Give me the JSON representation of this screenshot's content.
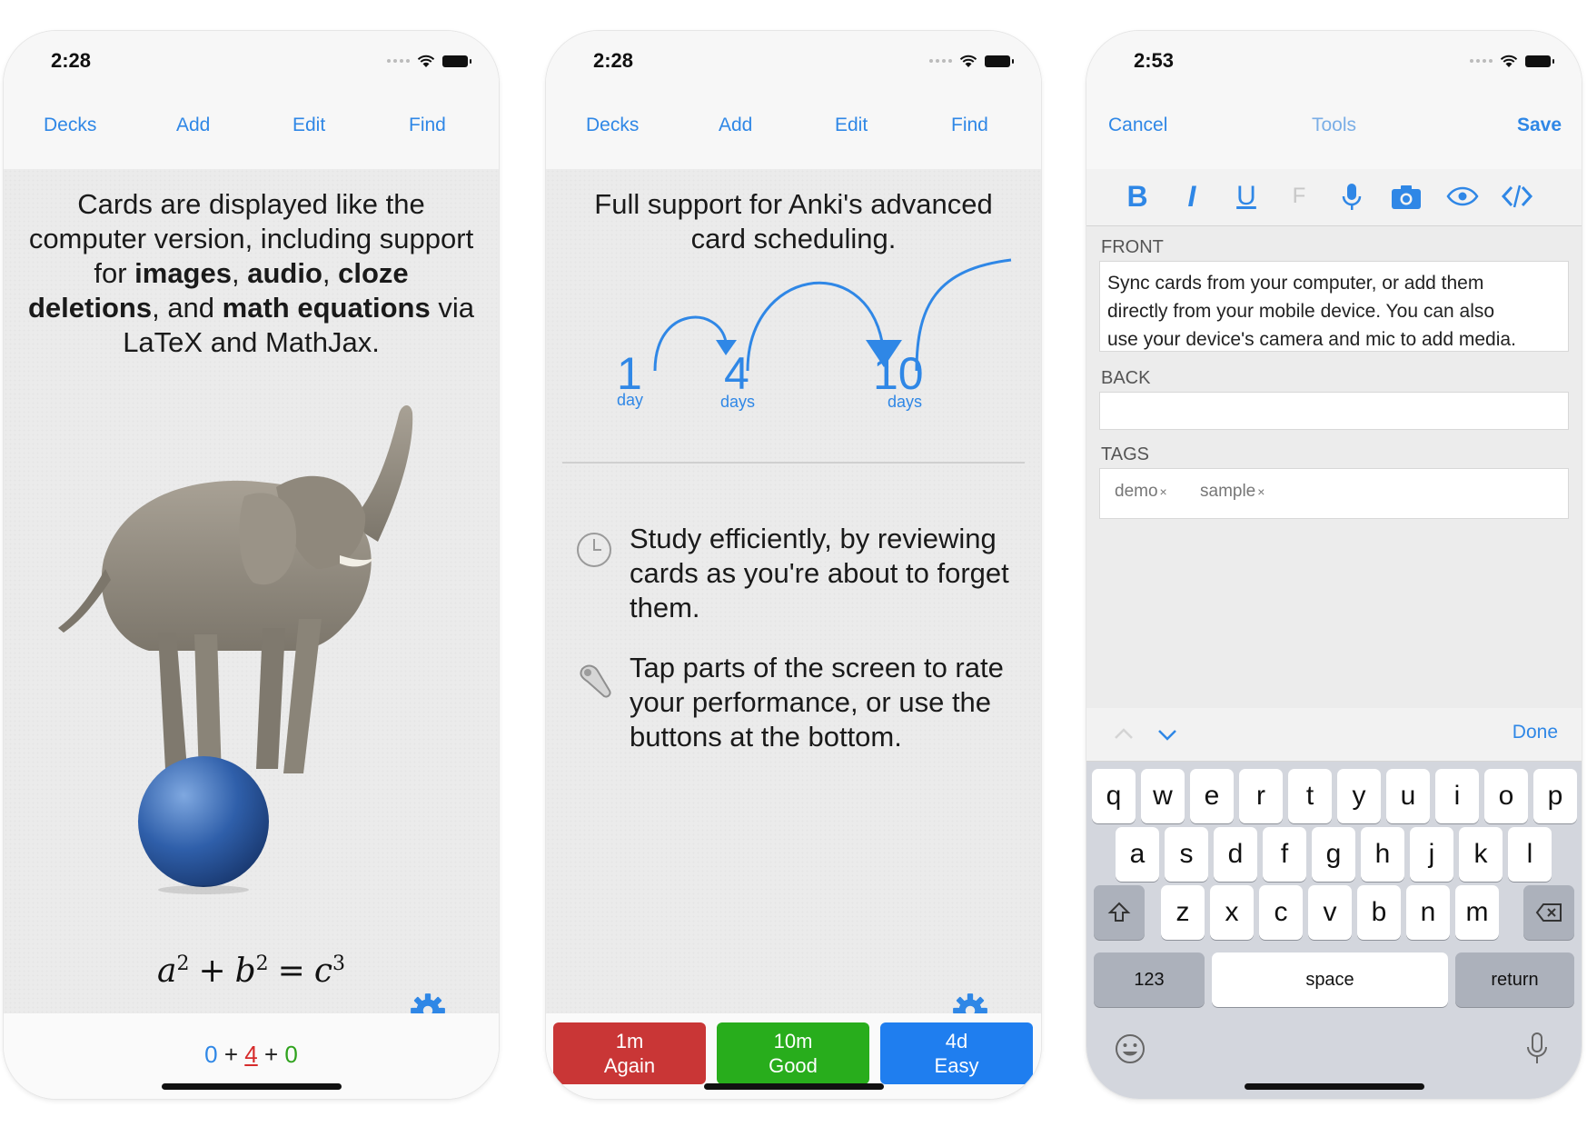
{
  "phones": [
    {
      "status": {
        "time": "2:28"
      },
      "nav": {
        "decks": "Decks",
        "add": "Add",
        "edit": "Edit",
        "find": "Find"
      },
      "card": {
        "l1": "Cards are displayed like the",
        "l2": "computer version, including support",
        "l3a": "for ",
        "images": "images",
        "l3b": ", ",
        "audio": "audio",
        "l3c": ", ",
        "cloze": "cloze",
        "deletions": "deletions",
        "l4": ", and ",
        "math": "math equations",
        "l4b": " via",
        "l5": "LaTeX and MathJax."
      },
      "equation": {
        "a": "a",
        "b": "b",
        "c": "c",
        "e1": "2",
        "e2": "2",
        "e3": "3",
        "plus": "+",
        "eq": "="
      },
      "counts": {
        "new": "0",
        "learn": "4",
        "review": "0",
        "plus": "+"
      },
      "icons": [
        "gear-icon",
        "elephant-on-ball-image"
      ]
    },
    {
      "status": {
        "time": "2:28"
      },
      "nav": {
        "decks": "Decks",
        "add": "Add",
        "edit": "Edit",
        "find": "Find"
      },
      "headline": {
        "l1": "Full support for Anki's advanced",
        "l2": "card scheduling."
      },
      "intervals": [
        {
          "num": "1",
          "unit": "day"
        },
        {
          "num": "4",
          "unit": "days"
        },
        {
          "num": "10",
          "unit": "days"
        }
      ],
      "features": [
        {
          "icon": "clock-icon",
          "l1": "Study efficiently, by reviewing",
          "l2": "cards as you're about to forget",
          "l3": "them."
        },
        {
          "icon": "tap-icon",
          "l1": "Tap parts of the screen to rate",
          "l2": "your performance, or use the",
          "l3": "buttons at the bottom."
        }
      ],
      "answers": [
        {
          "time": "1m",
          "label": "Again",
          "color": "#c93636"
        },
        {
          "time": "10m",
          "label": "Good",
          "color": "#28ad1c"
        },
        {
          "time": "4d",
          "label": "Easy",
          "color": "#1f7eef"
        }
      ]
    },
    {
      "status": {
        "time": "2:53"
      },
      "nav": {
        "cancel": "Cancel",
        "tools": "Tools",
        "save": "Save"
      },
      "toolbar": {
        "bold": "B",
        "italic": "I",
        "underline": "U",
        "sub": "F"
      },
      "fields": {
        "front_label": "FRONT",
        "front_l1": "Sync cards from your computer, or add them",
        "front_l2": "directly from your mobile device. You can also",
        "front_l3": "use your device's camera and mic to add media.",
        "back_label": "BACK",
        "tags_label": "TAGS",
        "tags": [
          "demo",
          "sample"
        ],
        "tag_remove": "×"
      },
      "accessory": {
        "done": "Done"
      },
      "keyboard": {
        "row1": [
          "q",
          "w",
          "e",
          "r",
          "t",
          "y",
          "u",
          "i",
          "o",
          "p"
        ],
        "row2": [
          "a",
          "s",
          "d",
          "f",
          "g",
          "h",
          "j",
          "k",
          "l"
        ],
        "row3": [
          "z",
          "x",
          "c",
          "v",
          "b",
          "n",
          "m"
        ],
        "numbers": "123",
        "space": "space",
        "return": "return"
      }
    }
  ],
  "colors": {
    "accent": "#2f87e6",
    "again": "#c93636",
    "good": "#28ad1c",
    "easy": "#1f7eef"
  }
}
